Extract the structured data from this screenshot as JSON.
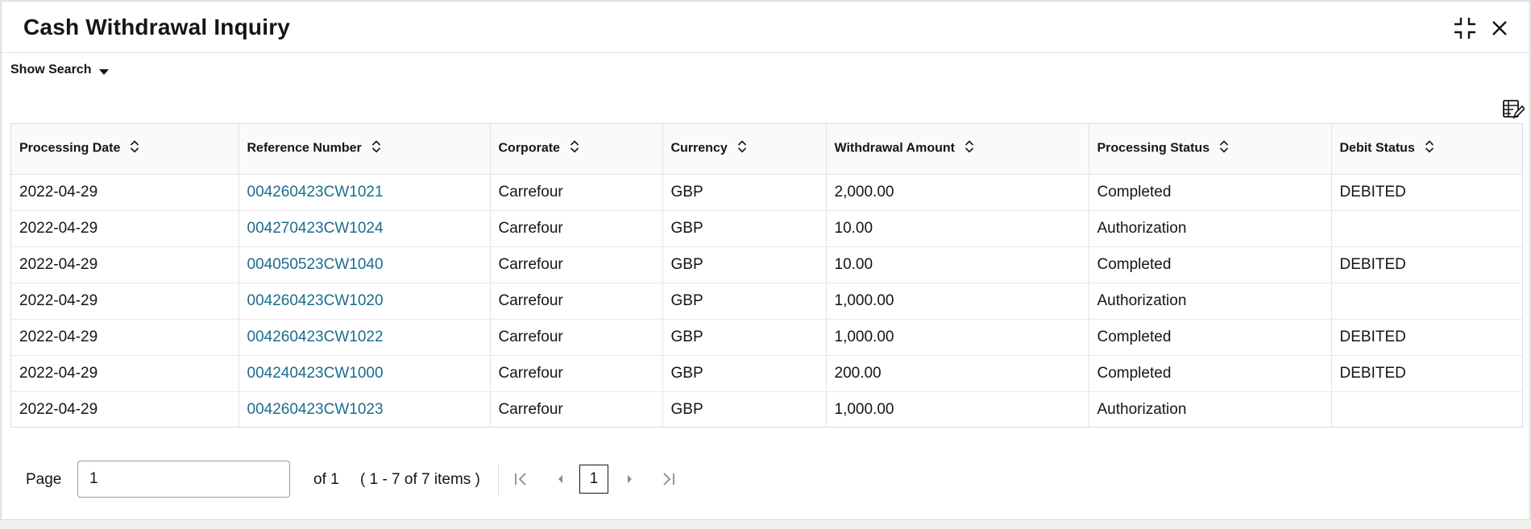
{
  "window": {
    "title": "Cash Withdrawal Inquiry"
  },
  "toolbar": {
    "show_search_label": "Show Search"
  },
  "table": {
    "columns": [
      "Processing Date",
      "Reference Number",
      "Corporate",
      "Currency",
      "Withdrawal Amount",
      "Processing Status",
      "Debit Status"
    ],
    "rows": [
      [
        "2022-04-29",
        "004260423CW1021",
        "Carrefour",
        "GBP",
        "2,000.00",
        "Completed",
        "DEBITED"
      ],
      [
        "2022-04-29",
        "004270423CW1024",
        "Carrefour",
        "GBP",
        "10.00",
        "Authorization",
        ""
      ],
      [
        "2022-04-29",
        "004050523CW1040",
        "Carrefour",
        "GBP",
        "10.00",
        "Completed",
        "DEBITED"
      ],
      [
        "2022-04-29",
        "004260423CW1020",
        "Carrefour",
        "GBP",
        "1,000.00",
        "Authorization",
        ""
      ],
      [
        "2022-04-29",
        "004260423CW1022",
        "Carrefour",
        "GBP",
        "1,000.00",
        "Completed",
        "DEBITED"
      ],
      [
        "2022-04-29",
        "004240423CW1000",
        "Carrefour",
        "GBP",
        "200.00",
        "Completed",
        "DEBITED"
      ],
      [
        "2022-04-29",
        "004260423CW1023",
        "Carrefour",
        "GBP",
        "1,000.00",
        "Authorization",
        ""
      ]
    ]
  },
  "pagination": {
    "page_label": "Page",
    "page_value": "1",
    "of_label": "of 1",
    "items_label": "( 1 - 7 of 7 items )",
    "current_page": "1"
  },
  "icons": {
    "minimize": "compress-icon",
    "close": "close-icon",
    "show_search": "caret-down-icon",
    "grid_settings": "edit-columns-icon",
    "sort": "sort-icon",
    "first_page": "first-page-icon",
    "prev_page": "previous-page-icon",
    "next_page": "next-page-icon",
    "last_page": "last-page-icon"
  },
  "colors": {
    "link": "#1b6c8e",
    "text": "#161513",
    "header_bg": "#fafafa",
    "border": "#dcdcdc"
  }
}
